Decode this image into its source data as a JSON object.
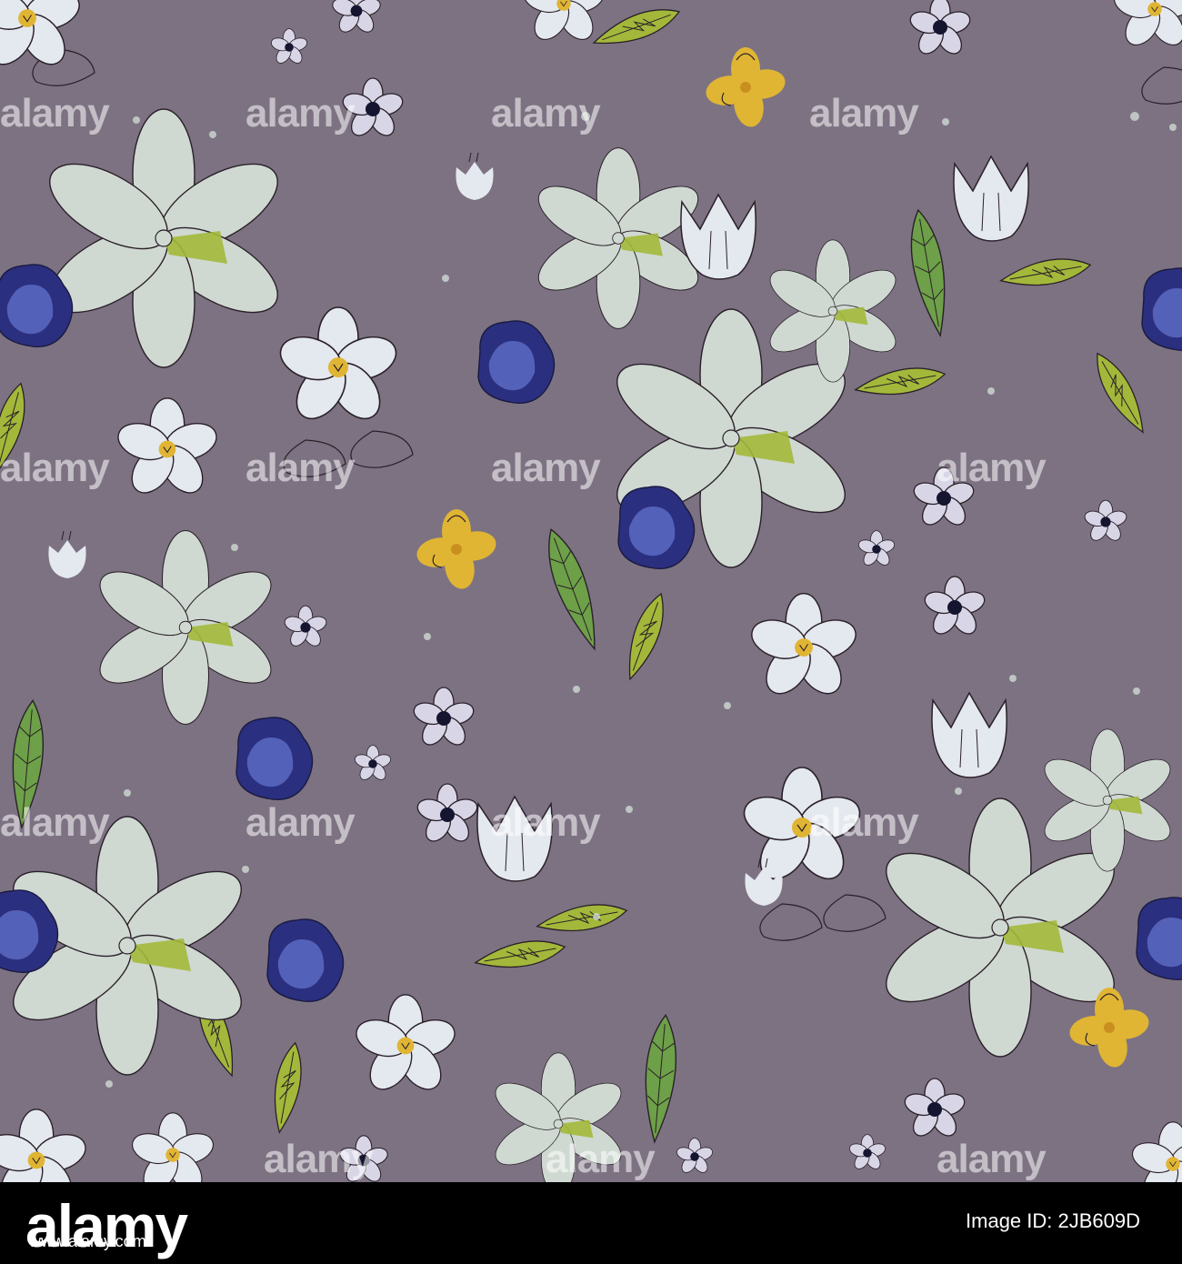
{
  "image": {
    "background_color": "#7c7282",
    "palette": {
      "white_petal": "#e4e8ef",
      "sage_petal": "#cfd9d2",
      "navy": "#2b2f7f",
      "periwinkle": "#5461b8",
      "yellow": "#e0b534",
      "leaf_green": "#6da048",
      "olive": "#a3b83a",
      "outline": "#2a2028"
    }
  },
  "watermark": {
    "text": "alamy"
  },
  "footer": {
    "logo": "alamy",
    "image_id": "Image ID: 2JB609D",
    "url": "www.alamy.com"
  }
}
